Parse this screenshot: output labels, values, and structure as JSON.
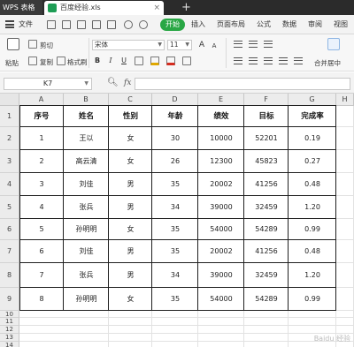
{
  "titlebar": {
    "app_name": "WPS 表格",
    "tab_name": "百度经验.xls",
    "close_glyph": "×",
    "new_tab_glyph": "+"
  },
  "menubar": {
    "file_label": "文件",
    "tabs": [
      "开始",
      "插入",
      "页面布局",
      "公式",
      "数据",
      "审阅",
      "视图"
    ],
    "active_tab": "开始",
    "accent_color": "#29a745"
  },
  "ribbon": {
    "paste_label": "粘贴",
    "cut_label": "剪切",
    "copy_label": "复制",
    "format_painter_label": "格式刷",
    "font_name": "宋体",
    "font_size": "11",
    "bold": "B",
    "italic": "I",
    "underline": "U",
    "grow_font": "A",
    "shrink_font": "A",
    "merge_center_label": "合并居中"
  },
  "formula_bar": {
    "cell_ref": "K7",
    "fx_label": "fx",
    "content": ""
  },
  "sheet": {
    "columns": [
      "A",
      "B",
      "C",
      "D",
      "E",
      "F",
      "G",
      "H"
    ],
    "rows": [
      "1",
      "2",
      "3",
      "4",
      "5",
      "6",
      "7",
      "8",
      "9",
      "10",
      "11",
      "12",
      "13",
      "14"
    ],
    "header": [
      "序号",
      "姓名",
      "性别",
      "年龄",
      "绩效",
      "目标",
      "完成率"
    ],
    "data": [
      [
        "1",
        "王以",
        "女",
        "30",
        "10000",
        "52201",
        "0.19"
      ],
      [
        "2",
        "高云清",
        "女",
        "26",
        "12300",
        "45823",
        "0.27"
      ],
      [
        "3",
        "刘佳",
        "男",
        "35",
        "20002",
        "41256",
        "0.48"
      ],
      [
        "4",
        "张兵",
        "男",
        "34",
        "39000",
        "32459",
        "1.20"
      ],
      [
        "5",
        "孙明明",
        "女",
        "35",
        "54000",
        "54289",
        "0.99"
      ],
      [
        "6",
        "刘佳",
        "男",
        "35",
        "20002",
        "41256",
        "0.48"
      ],
      [
        "7",
        "张兵",
        "男",
        "34",
        "39000",
        "32459",
        "1.20"
      ],
      [
        "8",
        "孙明明",
        "女",
        "35",
        "54000",
        "54289",
        "0.99"
      ]
    ]
  },
  "watermark": "Baidu 经验"
}
